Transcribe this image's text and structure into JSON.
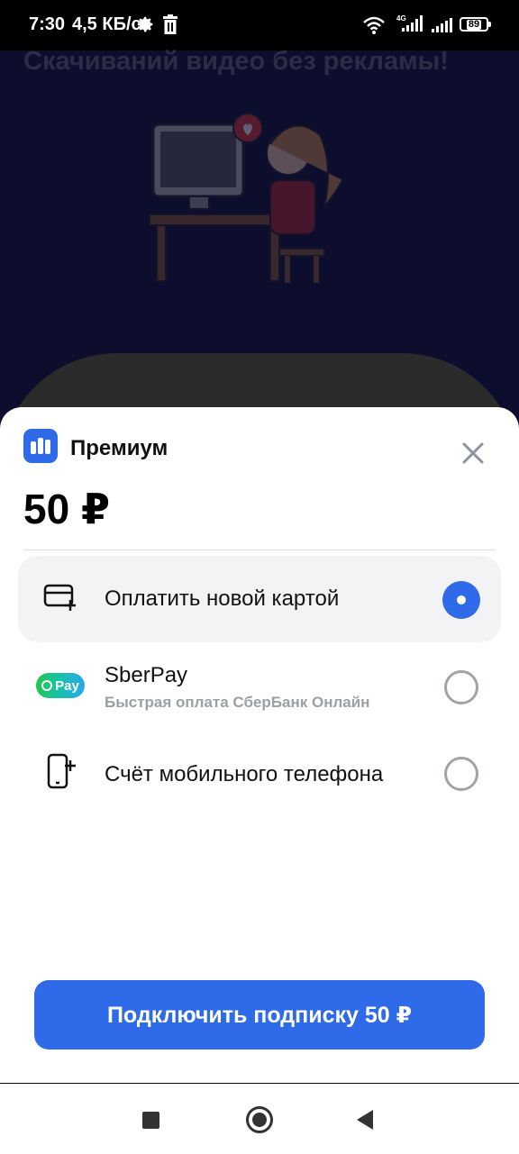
{
  "status_bar": {
    "time": "7:30",
    "speed": "4,5 КБ/с",
    "network": "4G",
    "battery": "89",
    "icons": [
      "gear-icon",
      "trash-icon",
      "wifi-icon",
      "signal-icon",
      "battery-icon"
    ]
  },
  "background": {
    "title": "Скачиваний видео без рекламы!"
  },
  "sheet": {
    "app_name": "Премиум",
    "price": "50 ₽",
    "options": [
      {
        "title": "Оплатить новой картой",
        "subtitle": "",
        "selected": true,
        "icon": "add-card-icon"
      },
      {
        "title": "SberPay",
        "subtitle": "Быстрая оплата СберБанк Онлайн",
        "selected": false,
        "icon": "sberpay-logo",
        "badge": "Pay"
      },
      {
        "title": "Счёт мобильного телефона",
        "subtitle": "",
        "selected": false,
        "icon": "mobile-phone-icon"
      }
    ],
    "cta_label": "Подключить подписку 50 ₽"
  },
  "colors": {
    "accent": "#2f6be8",
    "radio_off": "#9ea3ab",
    "selected_bg": "#f2f3f5"
  }
}
